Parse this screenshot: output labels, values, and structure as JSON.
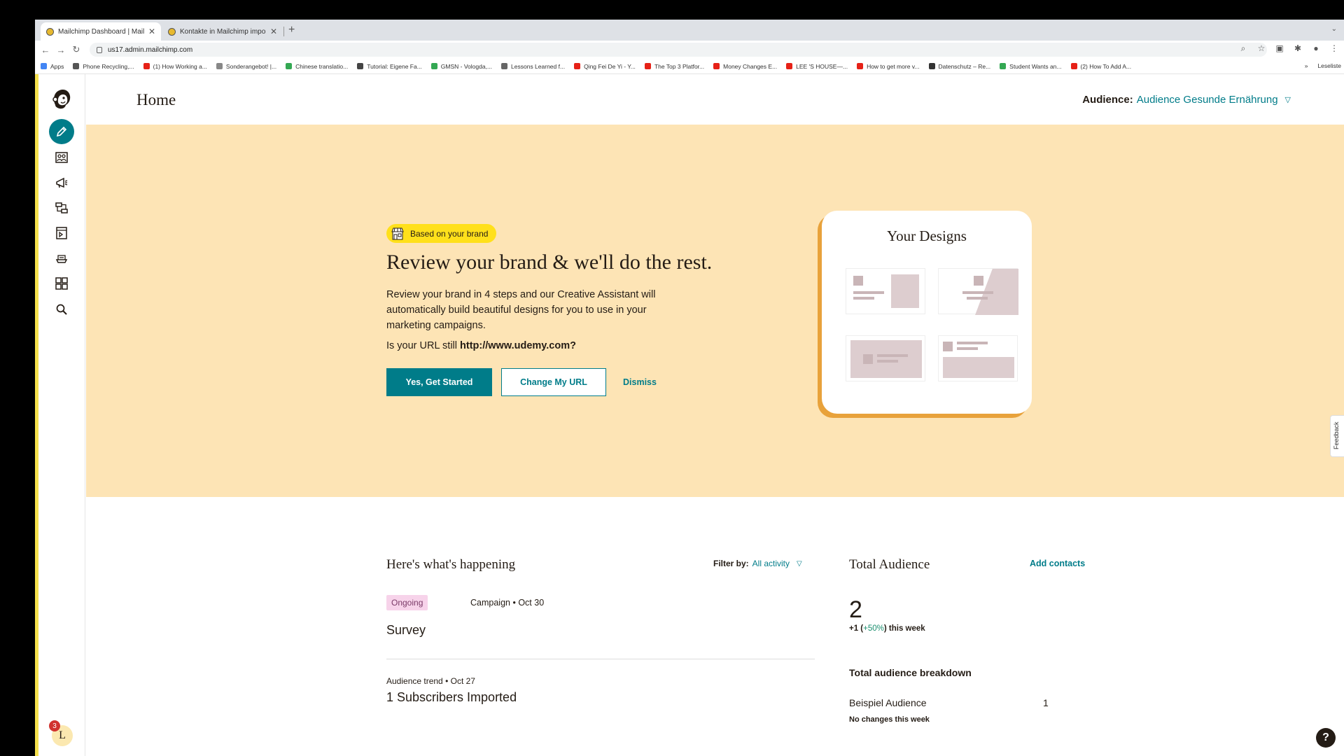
{
  "browser": {
    "tabs": [
      {
        "title": "Mailchimp Dashboard | Mailch..."
      },
      {
        "title": "Kontakte in Mailchimp importi..."
      }
    ],
    "url": "us17.admin.mailchimp.com",
    "bookmarks": [
      {
        "label": "Apps",
        "color": "#4285f4"
      },
      {
        "label": "Phone Recycling,...",
        "color": "#555555"
      },
      {
        "label": "(1) How Working a...",
        "color": "#e62117"
      },
      {
        "label": "Sonderangebot! |...",
        "color": "#888888"
      },
      {
        "label": "Chinese translatio...",
        "color": "#34a853"
      },
      {
        "label": "Tutorial: Eigene Fa...",
        "color": "#444444"
      },
      {
        "label": "GMSN - Vologda,...",
        "color": "#34a853"
      },
      {
        "label": "Lessons Learned f...",
        "color": "#666666"
      },
      {
        "label": "Qing Fei De Yi - Y...",
        "color": "#e62117"
      },
      {
        "label": "The Top 3 Platfor...",
        "color": "#e62117"
      },
      {
        "label": "Money Changes E...",
        "color": "#e62117"
      },
      {
        "label": "LEE 'S HOUSE—...",
        "color": "#e62117"
      },
      {
        "label": "How to get more v...",
        "color": "#e62117"
      },
      {
        "label": "Datenschutz – Re...",
        "color": "#333333"
      },
      {
        "label": "Student Wants an...",
        "color": "#34a853"
      },
      {
        "label": "(2) How To Add A...",
        "color": "#e62117"
      }
    ],
    "more_bookmarks": "»",
    "reading_list": "Leseliste"
  },
  "sidebar": {
    "items": [
      {
        "name": "create-pencil-icon"
      },
      {
        "name": "audience-icon"
      },
      {
        "name": "campaigns-megaphone-icon"
      },
      {
        "name": "automations-icon"
      },
      {
        "name": "website-icon"
      },
      {
        "name": "content-studio-icon"
      },
      {
        "name": "integrations-grid-icon"
      },
      {
        "name": "search-icon"
      }
    ],
    "notification_count": "3",
    "avatar_initial": "L"
  },
  "header": {
    "title": "Home",
    "audience_label": "Audience:",
    "audience_value": "Audience Gesunde Ernährung"
  },
  "hero": {
    "tag": "Based on your brand",
    "title": "Review your brand & we'll do the rest.",
    "body": "Review your brand in 4 steps and our Creative Assistant will automatically build beautiful designs for you to use in your marketing campaigns.",
    "url_question": "Is your URL still",
    "url": "http://www.udemy.com?",
    "primary_button": "Yes, Get Started",
    "secondary_button": "Change My URL",
    "dismiss": "Dismiss",
    "designs_title": "Your Designs"
  },
  "feedback": "Feedback",
  "happening": {
    "title": "Here's what's happening",
    "filter_label": "Filter by:",
    "filter_value": "All activity",
    "items": [
      {
        "status": "Ongoing",
        "type": "Campaign",
        "date": "• Oct 30",
        "name": "Survey"
      },
      {
        "type": "Audience trend",
        "date": "• Oct 27",
        "name": "1 Subscribers Imported"
      }
    ]
  },
  "audience": {
    "title": "Total Audience",
    "add_contacts": "Add contacts",
    "total": "2",
    "change_prefix": "+1 (",
    "change_pct": "+50%",
    "change_suffix": ") this week",
    "breakdown_title": "Total audience breakdown",
    "breakdown": [
      {
        "name": "Beispiel Audience",
        "value": "1",
        "note": "No changes this week"
      }
    ]
  },
  "help": "?"
}
